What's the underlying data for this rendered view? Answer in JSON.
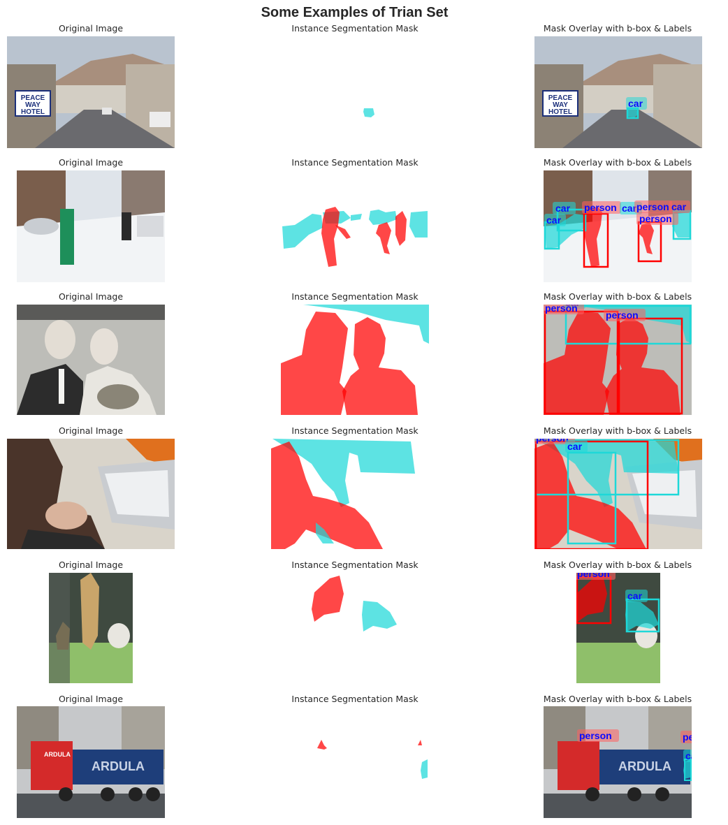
{
  "figure": {
    "title": "Some Examples of Trian Set"
  },
  "columns": {
    "original": "Original Image",
    "mask": "Instance Segmentation Mask",
    "overlay": "Mask Overlay with b-box & Labels"
  },
  "classes": {
    "person": {
      "label": "person",
      "color": "#ff0000"
    },
    "car": {
      "label": "car",
      "color": "#1ed8d8"
    }
  },
  "samples": [
    {
      "scene": "street-with-hotel-sign",
      "sign_text": [
        "PEACE",
        "WAY",
        "HOTEL"
      ],
      "labels": [
        "car"
      ]
    },
    {
      "scene": "snowy-street-skiers",
      "labels": [
        "car",
        "person",
        "car",
        "person",
        "car",
        "car",
        "person"
      ]
    },
    {
      "scene": "wedding-couple-in-car",
      "labels": [
        "car",
        "person",
        "person"
      ]
    },
    {
      "scene": "person-at-laptop",
      "labels": [
        "car",
        "person",
        "car"
      ]
    },
    {
      "scene": "shop-window-figurines",
      "labels": [
        "person",
        "car"
      ]
    },
    {
      "scene": "red-truck-city-street",
      "truck_text": [
        "ARDULA",
        "ARDULA"
      ],
      "labels": [
        "person",
        "person",
        "car"
      ]
    }
  ]
}
